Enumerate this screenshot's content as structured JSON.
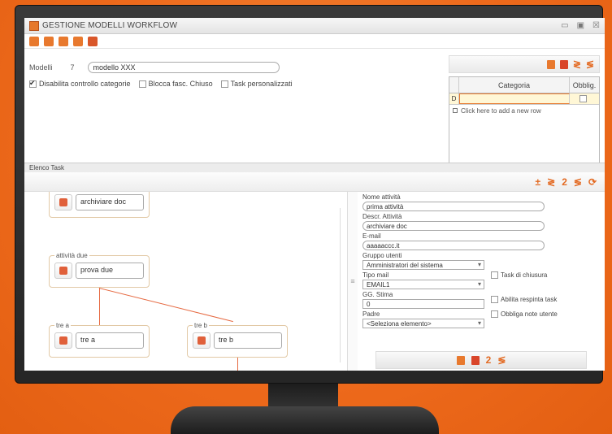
{
  "window": {
    "title": "GESTIONE MODELLI WORKFLOW",
    "controls": [
      "▭",
      "▣",
      "☒"
    ]
  },
  "form": {
    "modelli_label": "Modelli",
    "modelli_id": "7",
    "modelli_value": "modello XXX",
    "checkboxes": [
      {
        "label": "Disabilita controllo categorie",
        "checked": true
      },
      {
        "label": "Blocca fasc. Chiuso",
        "checked": false
      },
      {
        "label": "Task personalizzati",
        "checked": false
      }
    ]
  },
  "category_grid": {
    "headers": [
      "Categoria",
      "Obblig."
    ],
    "row_marker": "D",
    "add_row_text": "Click here to add a new row"
  },
  "section": {
    "title": "Elenco Task"
  },
  "canvas": {
    "top_node": "archiviare doc",
    "group_due": {
      "label": "attività due",
      "box": "prova due"
    },
    "group_tre_a": {
      "label": "tre a",
      "box": "tre a"
    },
    "group_tre_b": {
      "label": "tre b",
      "box": "tre b"
    },
    "splitter": "≡"
  },
  "detail": {
    "nome_label": "Nome attività",
    "nome_value": "prima attività",
    "descr_label": "Descr. Attività",
    "descr_value": "archiviare doc",
    "email_label": "E-mail",
    "email_value": "aaaaaccc.it",
    "gruppo_label": "Gruppo utenti",
    "gruppo_value": "Amministratori del sistema",
    "tipo_label": "Tipo mail",
    "tipo_value": "EMAIL1",
    "stima_label": "GG. Stima",
    "stima_value": "0",
    "padre_label": "Padre",
    "padre_value": "<Seleziona elemento>",
    "task_chiusura": "Task di chiusura",
    "abilita_respinta": "Abilita respinta task",
    "obbliga_note": "Obbliga note utente"
  },
  "icons": {
    "toolbar": [
      "save-icon",
      "add-user-icon",
      "add-group-icon",
      "add-user-icon",
      "exit-icon"
    ],
    "accent": "#e8792e"
  }
}
